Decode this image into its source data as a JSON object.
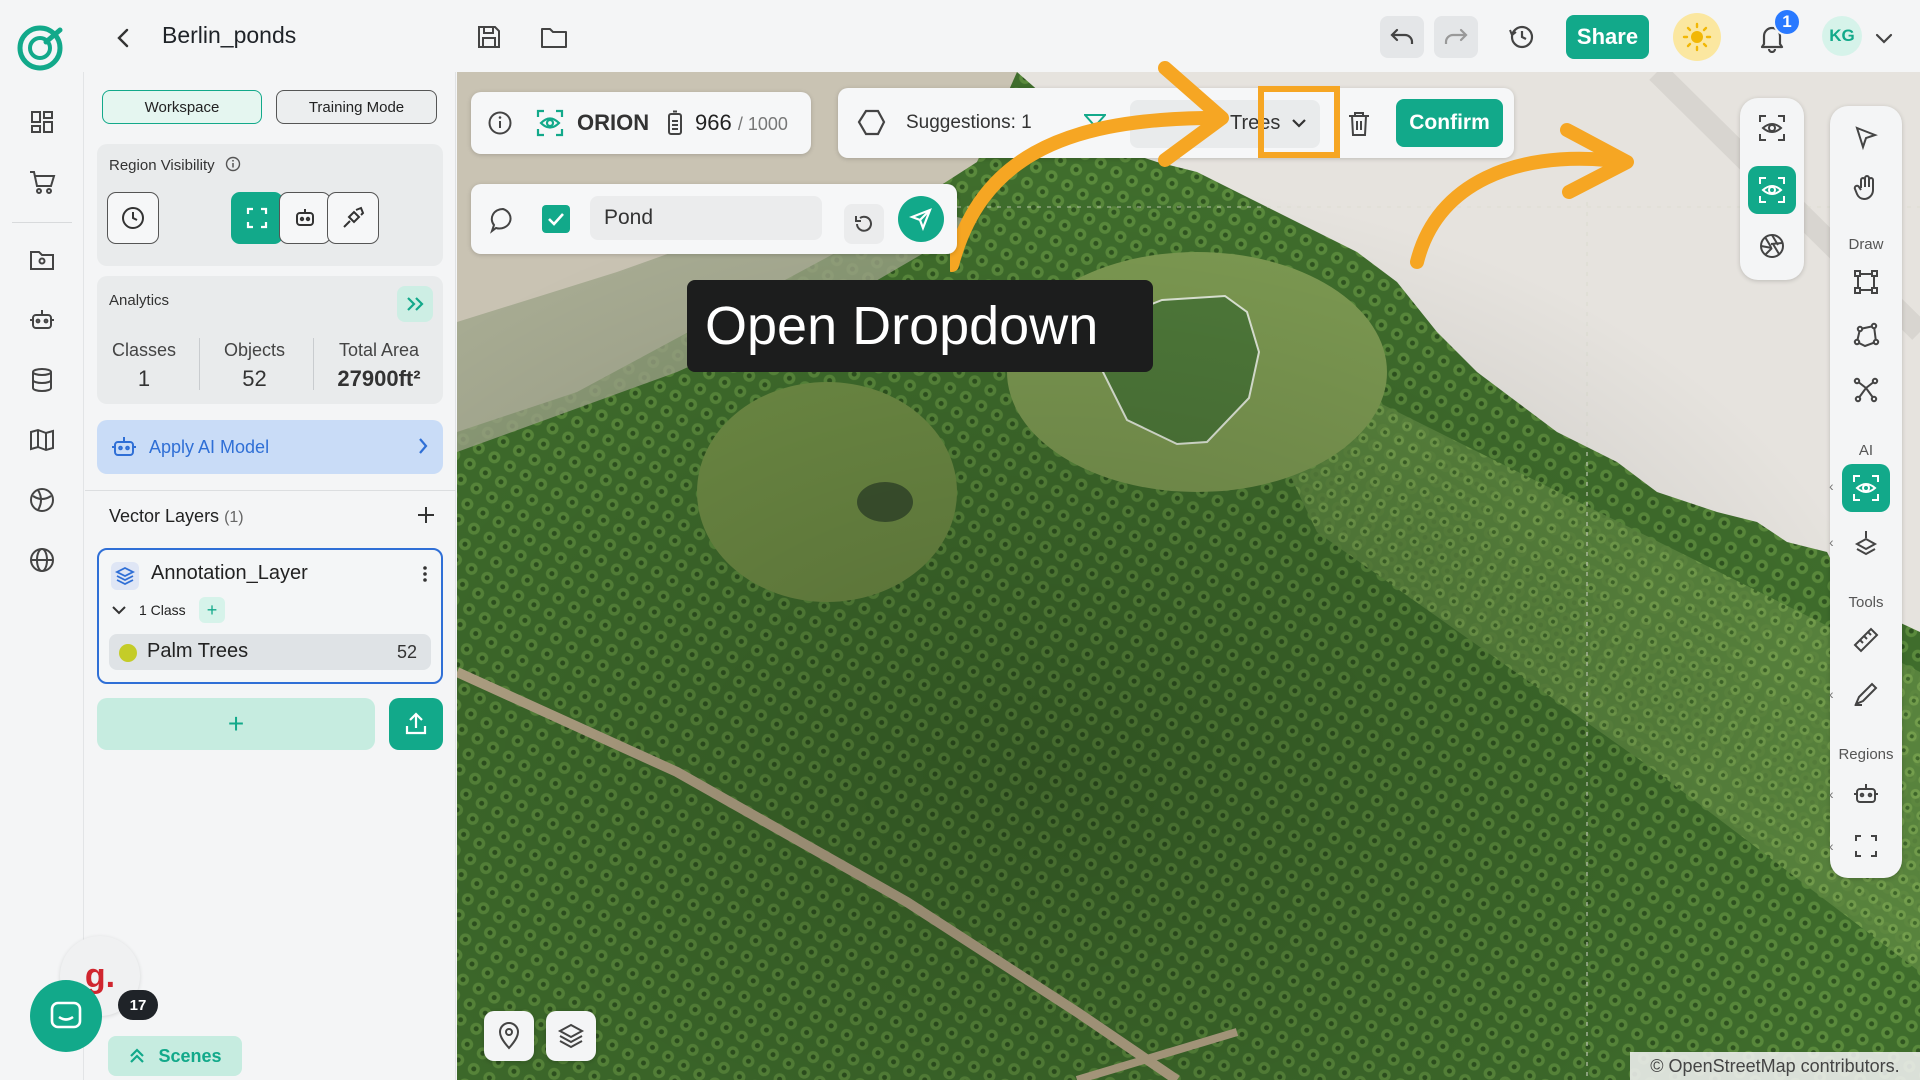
{
  "header": {
    "project_title": "Berlin_ponds",
    "share_label": "Share",
    "notification_count": "1",
    "user_initials": "KG"
  },
  "panel": {
    "tabs": {
      "workspace": "Workspace",
      "training": "Training Mode"
    },
    "region_visibility": {
      "title": "Region Visibility"
    },
    "analytics": {
      "title": "Analytics",
      "classes_label": "Classes",
      "classes_value": "1",
      "objects_label": "Objects",
      "objects_value": "52",
      "area_label": "Total Area",
      "area_value": "27900ft²"
    },
    "apply_model_label": "Apply AI Model",
    "vector_layers": {
      "title": "Vector Layers",
      "count": "(1)",
      "layer_name": "Annotation_Layer",
      "class_count": "1 Class",
      "class_name": "Palm Trees",
      "class_objects": "52",
      "class_color": "#c4cc28"
    },
    "g_badge_letter": "g.",
    "chat_badge_count": "17",
    "scenes_label": "Scenes"
  },
  "map": {
    "model": {
      "name": "ORION",
      "credits": "966",
      "credits_max": "/ 1000"
    },
    "suggestions": {
      "label": "Suggestions: 1",
      "class_select_value": "Trees"
    },
    "confirm_label": "Confirm",
    "prompt": {
      "value": "Pond"
    },
    "tooltip": "Open Dropdown",
    "attribution": "© OpenStreetMap contributors.",
    "right_toolbar": {
      "draw_label": "Draw",
      "ai_label": "AI",
      "tools_label": "Tools",
      "regions_label": "Regions"
    }
  },
  "colors": {
    "accent": "#12a98a",
    "highlight": "#f6a623",
    "selection_blue": "#2f6fd6"
  }
}
